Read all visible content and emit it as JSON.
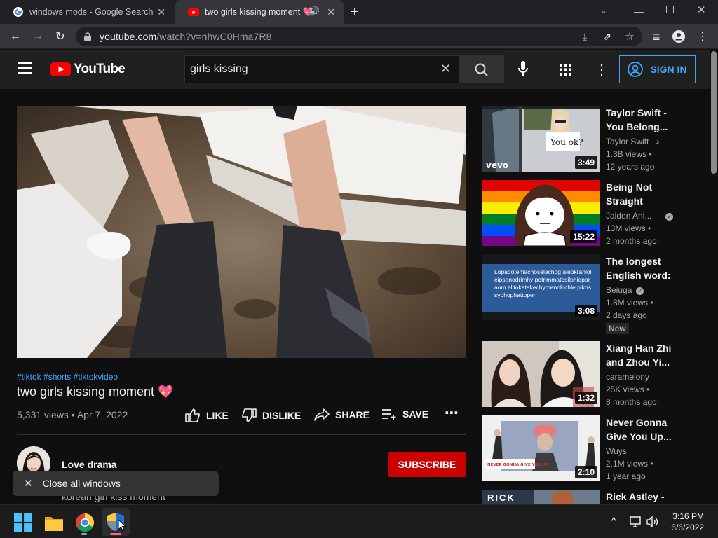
{
  "browser": {
    "tabs": [
      {
        "title": "windows mods - Google Search",
        "active": false
      },
      {
        "title": "two girls kissing moment 💖",
        "active": true
      }
    ],
    "url_host": "youtube.com",
    "url_path": "/watch?v=nhwC0Hma7R8"
  },
  "youtube": {
    "logo_text": "YouTube",
    "search_query": "girls kissing",
    "signin_label": "SIGN IN",
    "video": {
      "hashtags": "#tiktok #shorts #tiktokvideo",
      "title": "two girls kissing moment 💖",
      "meta": "5,331 views • Apr 7, 2022",
      "actions": {
        "like": "LIKE",
        "dislike": "DISLIKE",
        "share": "SHARE",
        "save": "SAVE"
      },
      "channel": "Love drama",
      "subscribe_label": "SUBSCRIBE",
      "description_peek": "korean girl kiss moment"
    },
    "recommendations": [
      {
        "title": "Taylor Swift - You Belong...",
        "channel": "Taylor Swift",
        "views": "1.3B views •",
        "age": "12 years ago",
        "duration": "3:49",
        "thumb_text": "You ok?",
        "watermark": "vevo"
      },
      {
        "title": "Being Not Straight",
        "channel": "Jaiden Ani...",
        "views": "13M views •",
        "age": "2 months ago",
        "duration": "15:22"
      },
      {
        "title": "The longest English word:",
        "channel": "Beiuga",
        "views": "1.8M views •",
        "age": "2 days ago",
        "duration": "3:08",
        "badge": "New",
        "thumb_text": "Lopadotemachoselachog aleokranioleipsanodrimhy potrimmatosilphioparaom elitokatakechymenokichle pikossyphophattoperi"
      },
      {
        "title": "Xiang Han Zhi and Zhou Yi...",
        "channel": "caramelony",
        "views": "25K views •",
        "age": "8 months ago",
        "duration": "1:32"
      },
      {
        "title": "Never Gonna Give You Up...",
        "channel": "Wuys",
        "views": "2.1M views •",
        "age": "1 year ago",
        "duration": "2:10",
        "thumb_text": "NEVER GONNA GIVE YOU UP"
      },
      {
        "title": "Rick Astley -",
        "thumb_text": "RICK"
      }
    ]
  },
  "toast": {
    "label": "Close all windows"
  },
  "taskbar": {
    "time": "3:16 PM",
    "date": "6/6/2022"
  }
}
